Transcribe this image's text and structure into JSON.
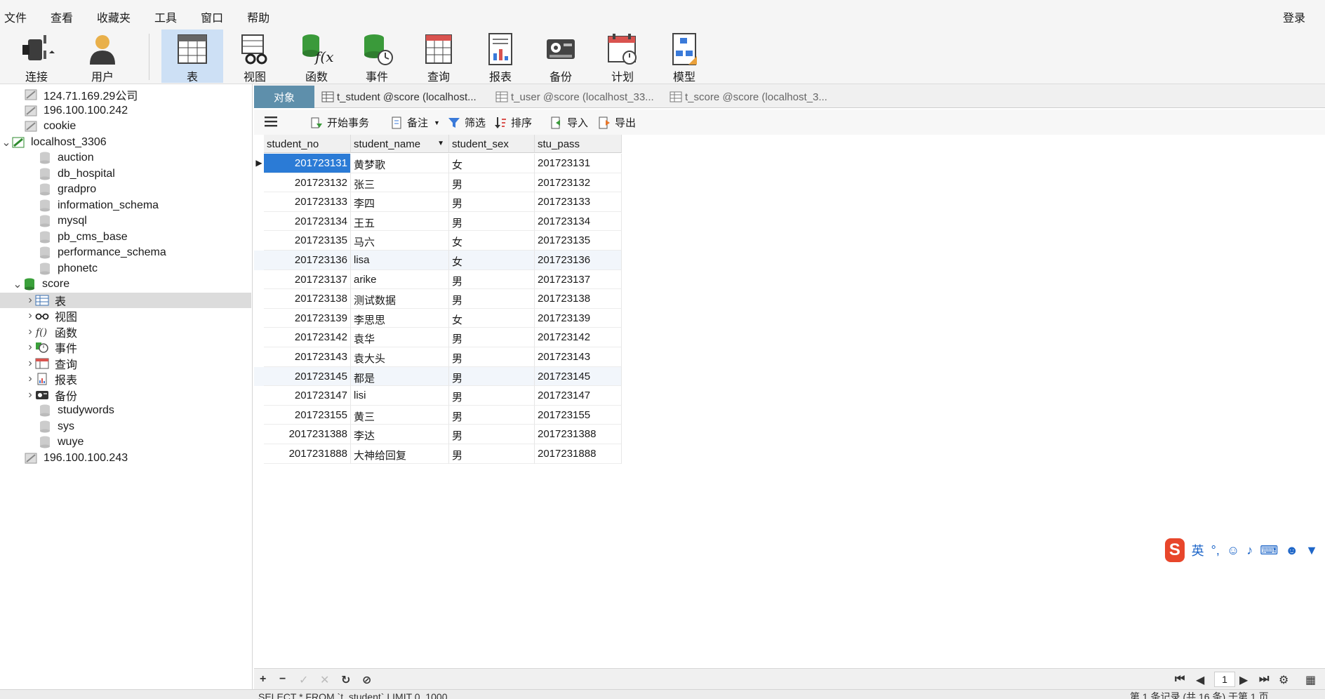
{
  "menubar": {
    "items": [
      "文件",
      "查看",
      "收藏夹",
      "工具",
      "窗口",
      "帮助"
    ],
    "login": "登录"
  },
  "toolbar": {
    "buttons": [
      {
        "label": "连接",
        "icon": "plug-icon"
      },
      {
        "label": "用户",
        "icon": "user-icon"
      },
      {
        "label": "表",
        "icon": "table-icon"
      },
      {
        "label": "视图",
        "icon": "view-icon"
      },
      {
        "label": "函数",
        "icon": "function-icon"
      },
      {
        "label": "事件",
        "icon": "event-icon"
      },
      {
        "label": "查询",
        "icon": "query-icon"
      },
      {
        "label": "报表",
        "icon": "report-icon"
      },
      {
        "label": "备份",
        "icon": "backup-icon"
      },
      {
        "label": "计划",
        "icon": "schedule-icon"
      },
      {
        "label": "模型",
        "icon": "model-icon"
      }
    ]
  },
  "sidebar": {
    "items": [
      {
        "label": "124.71.169.29公司"
      },
      {
        "label": "196.100.100.242"
      },
      {
        "label": "cookie"
      },
      {
        "label": "localhost_3306"
      },
      {
        "label": "auction"
      },
      {
        "label": "db_hospital"
      },
      {
        "label": "gradpro"
      },
      {
        "label": "information_schema"
      },
      {
        "label": "mysql"
      },
      {
        "label": "pb_cms_base"
      },
      {
        "label": "performance_schema"
      },
      {
        "label": "phonetc"
      },
      {
        "label": "score"
      },
      {
        "label": "表"
      },
      {
        "label": "视图"
      },
      {
        "label": "函数"
      },
      {
        "label": "事件"
      },
      {
        "label": "查询"
      },
      {
        "label": "报表"
      },
      {
        "label": "备份"
      },
      {
        "label": "studywords"
      },
      {
        "label": "sys"
      },
      {
        "label": "wuye"
      },
      {
        "label": "196.100.100.243"
      }
    ]
  },
  "tabs": {
    "object": "对象",
    "items": [
      "t_student @score (localhost...",
      "t_user @score (localhost_33...",
      "t_score @score (localhost_3..."
    ]
  },
  "subtoolbar": {
    "begin_tx": "开始事务",
    "note": "备注",
    "filter": "筛选",
    "sort": "排序",
    "import": "导入",
    "export": "导出"
  },
  "table": {
    "columns": [
      "student_no",
      "student_name",
      "student_sex",
      "stu_pass"
    ],
    "rows": [
      [
        "201723131",
        "黄梦歌",
        "女",
        "201723131"
      ],
      [
        "201723132",
        "张三",
        "男",
        "201723132"
      ],
      [
        "201723133",
        "李四",
        "男",
        "201723133"
      ],
      [
        "201723134",
        "王五",
        "男",
        "201723134"
      ],
      [
        "201723135",
        "马六",
        "女",
        "201723135"
      ],
      [
        "201723136",
        "lisa",
        "女",
        "201723136"
      ],
      [
        "201723137",
        "arike",
        "男",
        "201723137"
      ],
      [
        "201723138",
        "测试数据",
        "男",
        "201723138"
      ],
      [
        "201723139",
        "李思思",
        "女",
        "201723139"
      ],
      [
        "201723142",
        "袁华",
        "男",
        "201723142"
      ],
      [
        "201723143",
        "袁大头",
        "男",
        "201723143"
      ],
      [
        "201723145",
        "都是",
        "男",
        "201723145"
      ],
      [
        "201723147",
        "lisi",
        "男",
        "201723147"
      ],
      [
        "201723155",
        "黄三",
        "男",
        "201723155"
      ],
      [
        "2017231388",
        "李达",
        "男",
        "2017231388"
      ],
      [
        "2017231888",
        "大神给回复",
        "男",
        "2017231888"
      ]
    ]
  },
  "ime": {
    "logo": "S",
    "lang": "英"
  },
  "pager": {
    "page": "1"
  },
  "status": {
    "sql": "SELECT * FROM `t_student` LIMIT 0, 1000",
    "records": "第 1 条记录 (共 16 条) 于第 1 页"
  }
}
